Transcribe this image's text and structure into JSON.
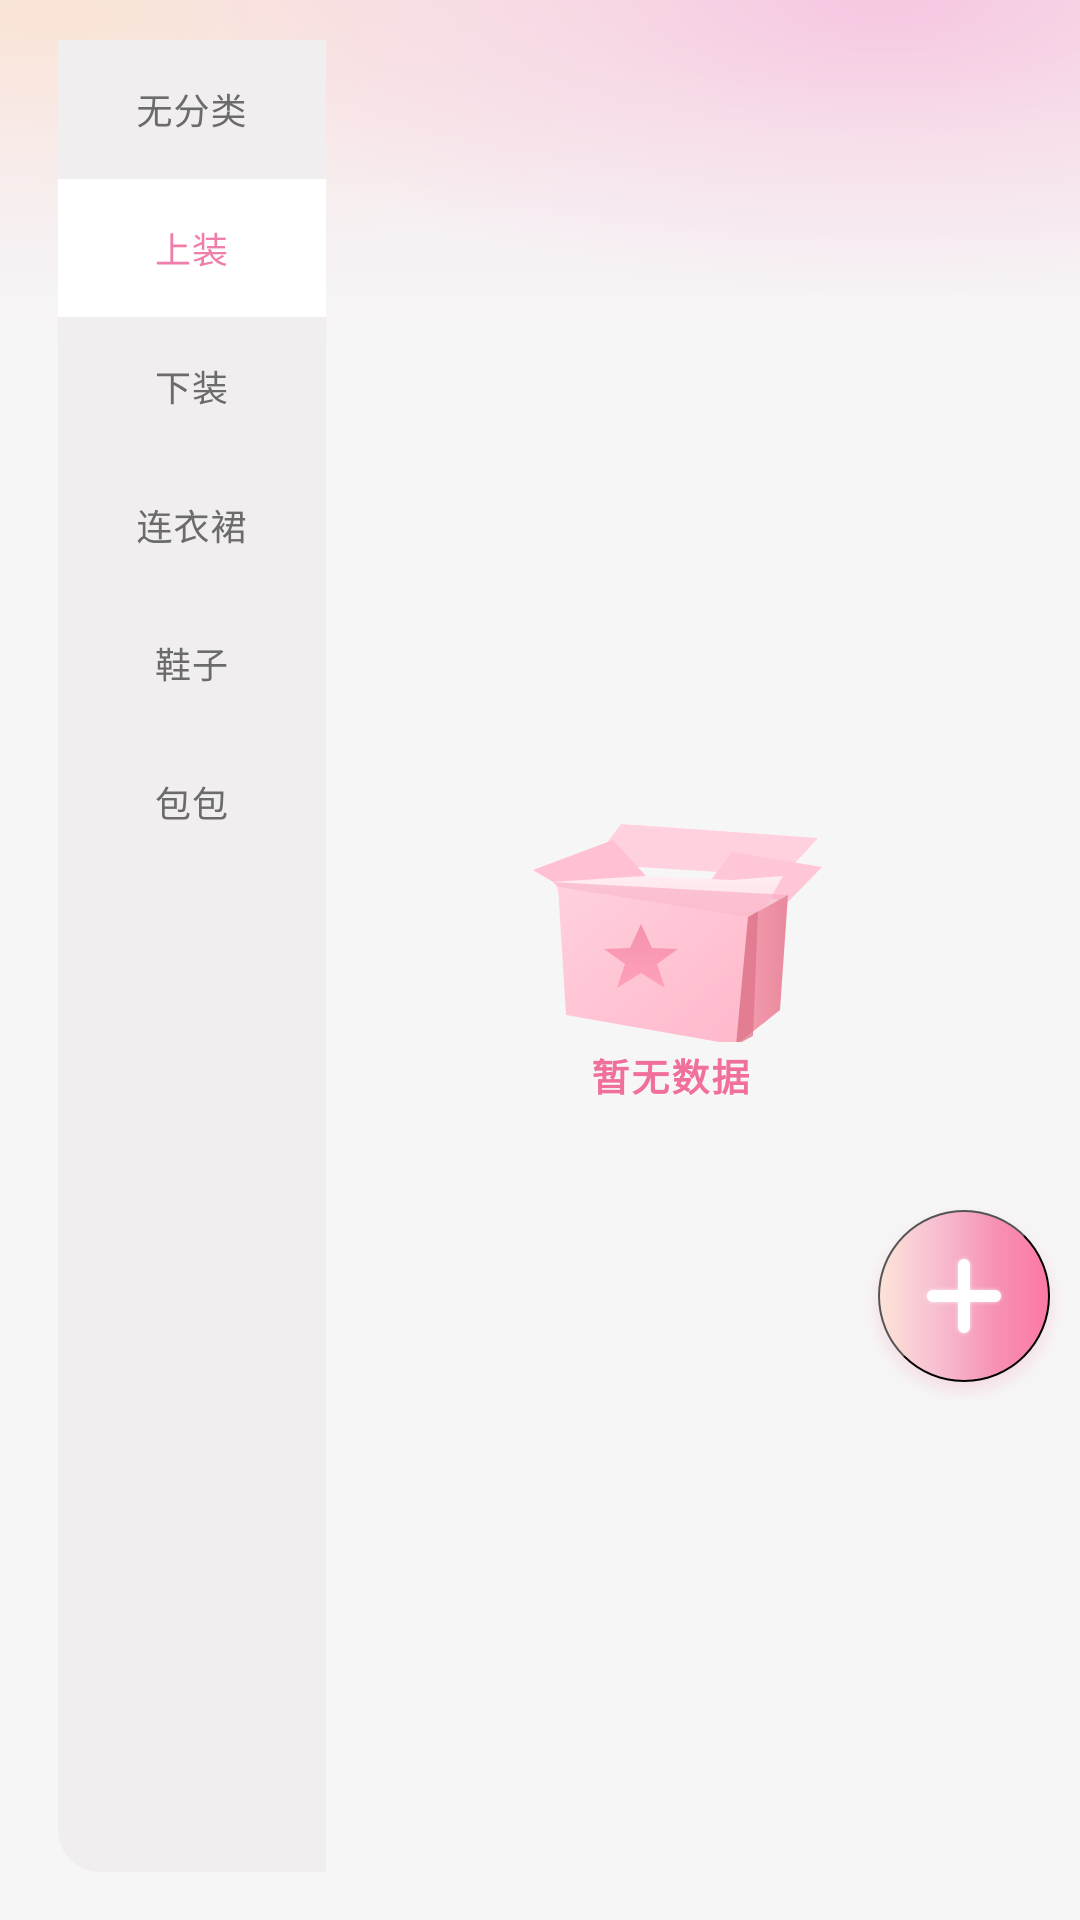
{
  "sidebar": {
    "items": [
      {
        "label": "无分类",
        "active": false
      },
      {
        "label": "上装",
        "active": true
      },
      {
        "label": "下装",
        "active": false
      },
      {
        "label": "连衣裙",
        "active": false
      },
      {
        "label": "鞋子",
        "active": false
      },
      {
        "label": "包包",
        "active": false
      }
    ]
  },
  "empty_state": {
    "icon": "gift-box-icon",
    "text": "暂无数据"
  },
  "fab": {
    "icon": "plus-icon"
  },
  "colors": {
    "accent": "#ef7eaa",
    "sidebar_bg": "#f1eeef",
    "active_bg": "#ffffff",
    "text": "#6b6b6b"
  }
}
